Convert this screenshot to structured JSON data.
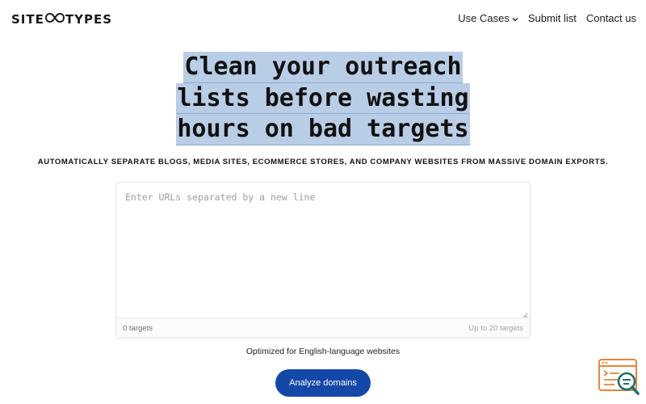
{
  "header": {
    "logo_left": "SITE",
    "logo_right": "TYPES",
    "nav": [
      {
        "label": "Use Cases",
        "has_dropdown": true
      },
      {
        "label": "Submit list"
      },
      {
        "label": "Contact us"
      }
    ]
  },
  "hero": {
    "headline_lines": [
      "Clean your outreach",
      "lists before wasting",
      "hours on bad targets"
    ],
    "subtitle": "AUTOMATICALLY SEPARATE BLOGS, MEDIA SITES, ECOMMERCE STORES, AND COMPANY WEBSITES FROM MASSIVE DOMAIN EXPORTS."
  },
  "input": {
    "placeholder": "Enter URLs separated by a new line",
    "value": "",
    "count_label": "0 targets",
    "limit_label": "Up to 20 targets"
  },
  "note": "Optimized for English-language websites",
  "cta": {
    "label": "Analyze domains"
  },
  "colors": {
    "accent": "#1448a8",
    "highlight": "#b9cde6",
    "widget_orange": "#e8863a",
    "widget_teal": "#1d6f6a"
  },
  "icons": [
    "infinity-logo-icon",
    "chevron-down-icon",
    "resize-grip-icon",
    "search-widget-icon"
  ]
}
